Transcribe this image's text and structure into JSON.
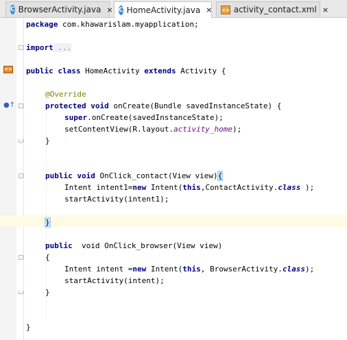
{
  "tabs": [
    {
      "label": "BrowserActivity.java",
      "icon": "class-icon",
      "active": false
    },
    {
      "label": "HomeActivity.java",
      "icon": "class-icon",
      "active": true
    },
    {
      "label": "activity_contact.xml",
      "icon": "xml-layout-icon",
      "active": false
    }
  ],
  "close_glyph": "×",
  "code": {
    "l1": {
      "kw": "package",
      "rest": " com.khawarislam.myapplication;"
    },
    "l2": {
      "kw": "import",
      "fold": " ..."
    },
    "l3": {
      "kw": "public class",
      "name": " HomeActivity ",
      "kw2": "extends",
      "rest": " Activity {"
    },
    "l4": {
      "ann": "@Override"
    },
    "l5": {
      "kw": "protected void",
      "rest": " onCreate(Bundle savedInstanceState) {"
    },
    "l6": {
      "kw": "super",
      "rest": ".onCreate(savedInstanceState);"
    },
    "l7": {
      "pre": "setContentView(R.layout.",
      "it": "activity_home",
      "post": ");"
    },
    "l8": {
      "text": "}"
    },
    "l9": {
      "kw": "public void",
      "rest": " OnClick_contact(View view)",
      "bracket": "{"
    },
    "l10": {
      "pre": "Intent intent1=",
      "kw": "new",
      "mid": " Intent(",
      "kw2": "this",
      "mid2": ",ContactActivity.",
      "kw3": "class",
      "post": " );"
    },
    "l11": {
      "text": "startActivity(intent1);"
    },
    "l12": {
      "bracket": "}"
    },
    "l13": {
      "kw": "public",
      "rest": "  void OnClick_browser(View view)"
    },
    "l14": {
      "text": "{"
    },
    "l15": {
      "pre": "Intent intent =",
      "kw": "new",
      "mid": " Intent(",
      "kw2": "this",
      "mid2": ", BrowserActivity.",
      "kw3": "class",
      "post": ");"
    },
    "l16": {
      "text": "startActivity(intent);"
    },
    "l17": {
      "text": "}"
    },
    "l18": {
      "text": "}"
    }
  }
}
